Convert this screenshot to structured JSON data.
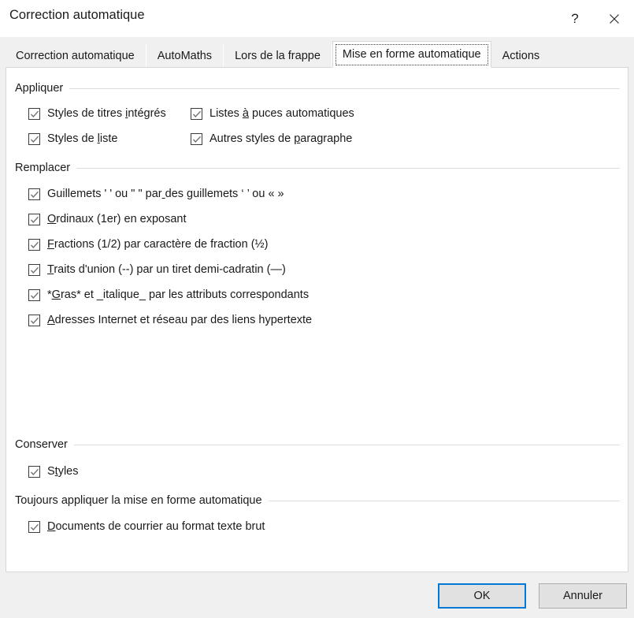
{
  "window": {
    "title": "Correction automatique",
    "help_icon": "question-mark-icon",
    "close_icon": "close-icon"
  },
  "tabs": [
    {
      "label": "Correction automatique",
      "selected": false
    },
    {
      "label": "AutoMaths",
      "selected": false
    },
    {
      "label": "Lors de la frappe",
      "selected": false
    },
    {
      "label": "Mise en forme automatique",
      "selected": true
    },
    {
      "label": "Actions",
      "selected": false
    }
  ],
  "groups": {
    "appliquer": {
      "label": "Appliquer",
      "items": [
        {
          "label": "Styles de titres intégrés",
          "accel_index": 17,
          "checked": true,
          "col": 0,
          "row": 0
        },
        {
          "label": "Listes à puces automatiques",
          "accel_index": 7,
          "checked": true,
          "col": 1,
          "row": 0
        },
        {
          "label": "Styles de liste",
          "accel_index": 10,
          "checked": true,
          "col": 0,
          "row": 1
        },
        {
          "label": "Autres styles de paragraphe",
          "accel_index": 17,
          "checked": true,
          "col": 1,
          "row": 1
        }
      ]
    },
    "remplacer": {
      "label": "Remplacer",
      "items": [
        {
          "label": "Guillemets ' ' ou \" \" par des guillemets ‘ ’ ou « »",
          "accel_index": 25,
          "checked": true
        },
        {
          "label": "Ordinaux (1er) en exposant",
          "accel_index": 0,
          "checked": true
        },
        {
          "label": "Fractions (1/2) par caractère de fraction (½)",
          "accel_index": 0,
          "checked": true
        },
        {
          "label": "Traits d'union (--) par un tiret demi-cadratin (—)",
          "accel_index": 0,
          "checked": true
        },
        {
          "label": "*Gras* et _italique_ par les attributs correspondants",
          "accel_index": 1,
          "checked": true
        },
        {
          "label": "Adresses Internet et réseau par des liens hypertexte",
          "accel_index": 0,
          "checked": true
        }
      ]
    },
    "conserver": {
      "label": "Conserver",
      "items": [
        {
          "label": "Styles",
          "accel_index": 1,
          "checked": true
        }
      ]
    },
    "toujours": {
      "label": "Toujours appliquer la mise en forme automatique",
      "items": [
        {
          "label": "Documents de courrier au format texte brut",
          "accel_index": 0,
          "checked": true
        }
      ]
    }
  },
  "footer": {
    "ok_label": "OK",
    "cancel_label": "Annuler"
  },
  "colors": {
    "accent": "#0078d7",
    "dialog_bg": "#f0f0f0",
    "panel_bg": "#ffffff",
    "rule": "#dcdcdc",
    "checkmark": "#6e6e6e"
  }
}
